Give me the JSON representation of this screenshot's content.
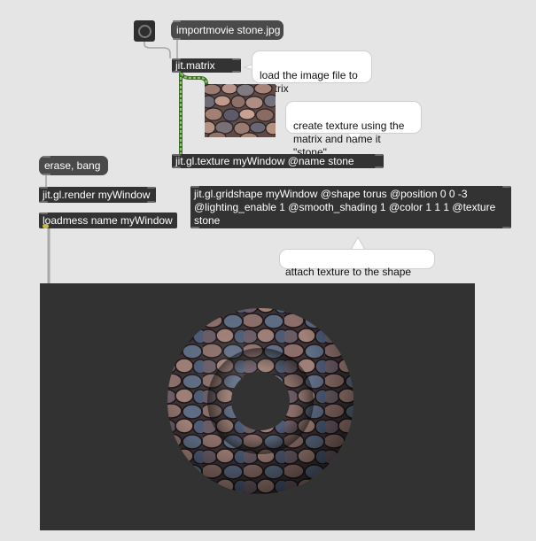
{
  "patch": {
    "objects": {
      "importmovie": "importmovie stone.jpg",
      "jit_matrix": "jit.matrix",
      "jit_gl_texture": "jit.gl.texture myWindow @name stone",
      "erase_bang": "erase, bang",
      "jit_gl_render": "jit.gl.render myWindow",
      "loadmess": "loadmess name myWindow",
      "gridshape_line1": "jit.gl.gridshape myWindow @shape torus @position 0 0 -3",
      "gridshape_line2": "@lighting_enable 1 @smooth_shading 1 @color 1 1 1 @texture",
      "gridshape_line3": "stone"
    },
    "comments": {
      "load_image": "load the image file to\nmatrix",
      "create_texture": "create texture using the\nmatrix and name it \"stone\"",
      "attach_texture": "attach texture to the shape"
    },
    "colors": {
      "canvas": "#e5e5e5",
      "object_box": "#333333",
      "message_box": "#4a4a4a",
      "matrix_patchcord": "#8cc56e",
      "render_window": "#323232"
    },
    "icons": [
      "bang-button-icon",
      "stone-texture-thumbnail",
      "torus-render"
    ]
  }
}
